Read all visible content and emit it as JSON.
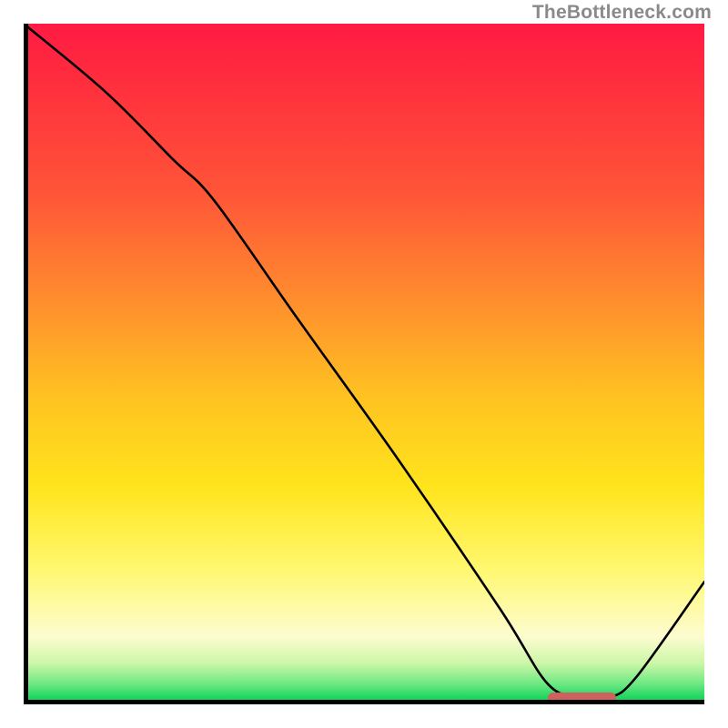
{
  "attribution": "TheBottleneck.com",
  "chart_data": {
    "type": "line",
    "title": "",
    "xlabel": "",
    "ylabel": "",
    "xlim": [
      0,
      100
    ],
    "ylim": [
      0,
      100
    ],
    "series": [
      {
        "name": "bottleneck-curve",
        "x": [
          0,
          12,
          22,
          28,
          40,
          55,
          70,
          77,
          82,
          86,
          90,
          100
        ],
        "y": [
          100,
          90,
          80,
          74,
          57,
          36,
          14,
          3,
          1,
          1,
          4,
          18
        ]
      }
    ],
    "markers": [
      {
        "name": "optimal-range",
        "x_start": 77,
        "x_end": 87,
        "y": 1
      }
    ],
    "gradient_stops": [
      {
        "pos": 0,
        "color": "#ff1a44"
      },
      {
        "pos": 25,
        "color": "#ff5538"
      },
      {
        "pos": 55,
        "color": "#ffc321"
      },
      {
        "pos": 80,
        "color": "#fff86e"
      },
      {
        "pos": 97,
        "color": "#6de882"
      },
      {
        "pos": 100,
        "color": "#0ecf52"
      }
    ]
  }
}
